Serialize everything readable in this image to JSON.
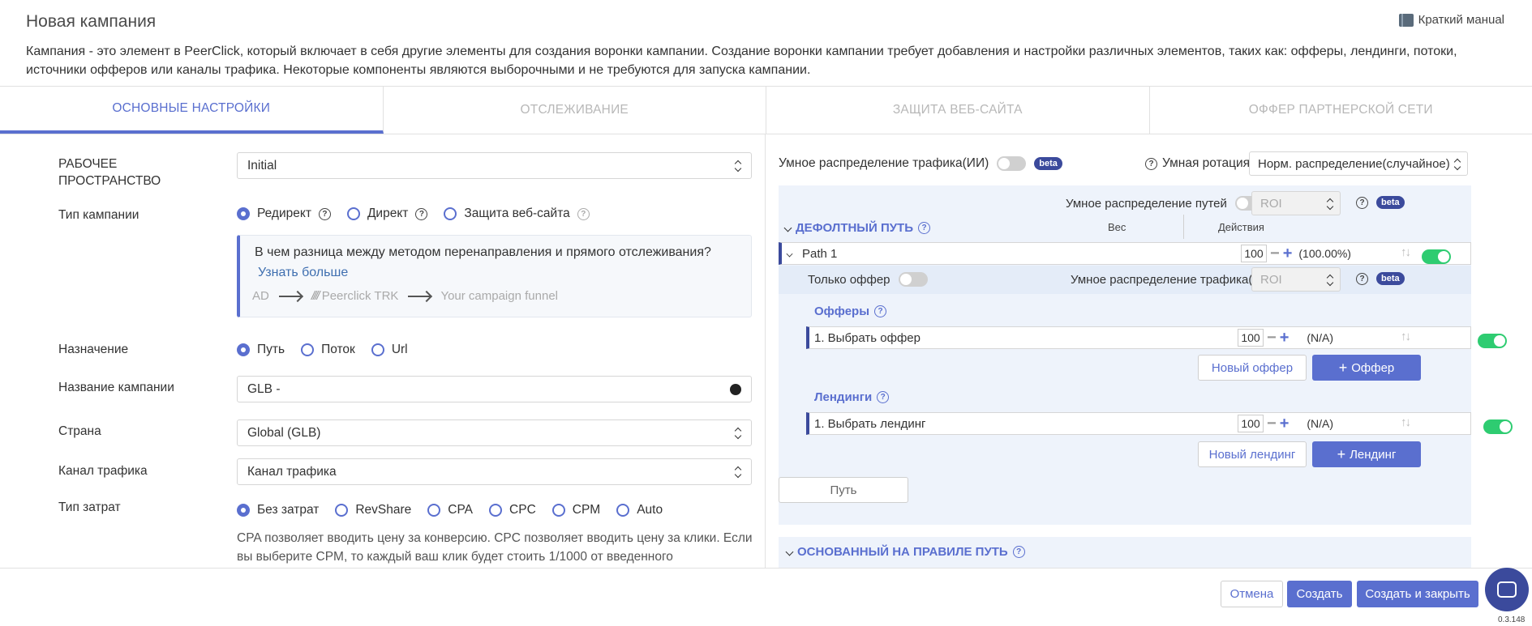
{
  "header": {
    "title": "Новая кампания",
    "manual": "Краткий манual",
    "description": "Кампания - это элемент в PeerClick, который включает в себя другие элементы для создания воронки кампании. Создание воронки кампании требует добавления и настройки различных элементов, таких как: офферы, лендинги, потоки, источники офферов или каналы трафика. Некоторые компоненты являются выборочными и не требуются для запуска кампании."
  },
  "tabs": [
    "ОСНОВНЫЕ НАСТРОЙКИ",
    "ОТСЛЕЖИВАНИЕ",
    "ЗАЩИТА ВЕБ-САЙТА",
    "ОФФЕР ПАРТНЕРСКОЙ СЕТИ"
  ],
  "left": {
    "workspace_label": "РАБОЧЕЕ ПРОСТРАНСТВО",
    "workspace_value": "Initial",
    "campaign_type_label": "Тип кампании",
    "campaign_types": [
      "Редирект",
      "Директ",
      "Защита веб-сайта"
    ],
    "info_question": "В чем разница между методом перенаправления и прямого отслеживания?",
    "info_link": "Узнать больше",
    "flow": [
      "AD",
      "Peerclick TRK",
      "Your campaign funnel"
    ],
    "destination_label": "Назначение",
    "destinations": [
      "Путь",
      "Поток",
      "Url"
    ],
    "name_label": "Название кампании",
    "name_value": "GLB -",
    "country_label": "Страна",
    "country_value": "Global (GLB)",
    "traffic_label": "Канал трафика",
    "traffic_value": "Канал трафика",
    "cost_label": "Тип затрат",
    "cost_types": [
      "Без затрат",
      "RevShare",
      "CPA",
      "CPC",
      "CPM",
      "Auto"
    ],
    "cost_help": "CPA позволяет вводить цену за конверсию. CPC позволяет вводить цену за клики. Если вы выберите CPM, то каждый ваш клик будет стоить 1/1000 от введенного"
  },
  "right": {
    "smart_traffic": "Умное распределение трафика(ИИ)",
    "beta": "beta",
    "smart_rotation": "Умная ротация",
    "rotation_value": "Норм. распределение(случайное)",
    "smart_paths": "Умное распределение путей",
    "roi": "ROI",
    "default_path": "ДЕФОЛТНЫЙ ПУТЬ",
    "col_weight": "Вес",
    "col_actions": "Действия",
    "path_name": "Path 1",
    "path_weight": "100",
    "path_pct": "(100.00%)",
    "offer_only": "Только оффер",
    "smart_traffic2": "Умное распределение трафика(ИИ)",
    "offers_title": "Офферы",
    "offer_row": "1. Выбрать оффер",
    "offer_weight": "100",
    "offer_pct": "(N/A)",
    "new_offer": "Новый оффер",
    "add_offer": "Оффер",
    "landings_title": "Лендинги",
    "landing_row": "1. Выбрать лендинг",
    "landing_weight": "100",
    "landing_pct": "(N/A)",
    "new_landing": "Новый лендинг",
    "add_landing": "Лендинг",
    "path_button": "Путь",
    "rule_path": "ОСНОВАННЫЙ НА ПРАВИЛЕ ПУТЬ"
  },
  "footer": {
    "cancel": "Отмена",
    "create": "Создать",
    "create_close": "Создать и закрыть",
    "version": "0.3.148"
  },
  "colors": {
    "accent": "#5a6fcf",
    "dark_accent": "#3b4a9c",
    "toggle_on": "#2ecc71"
  }
}
